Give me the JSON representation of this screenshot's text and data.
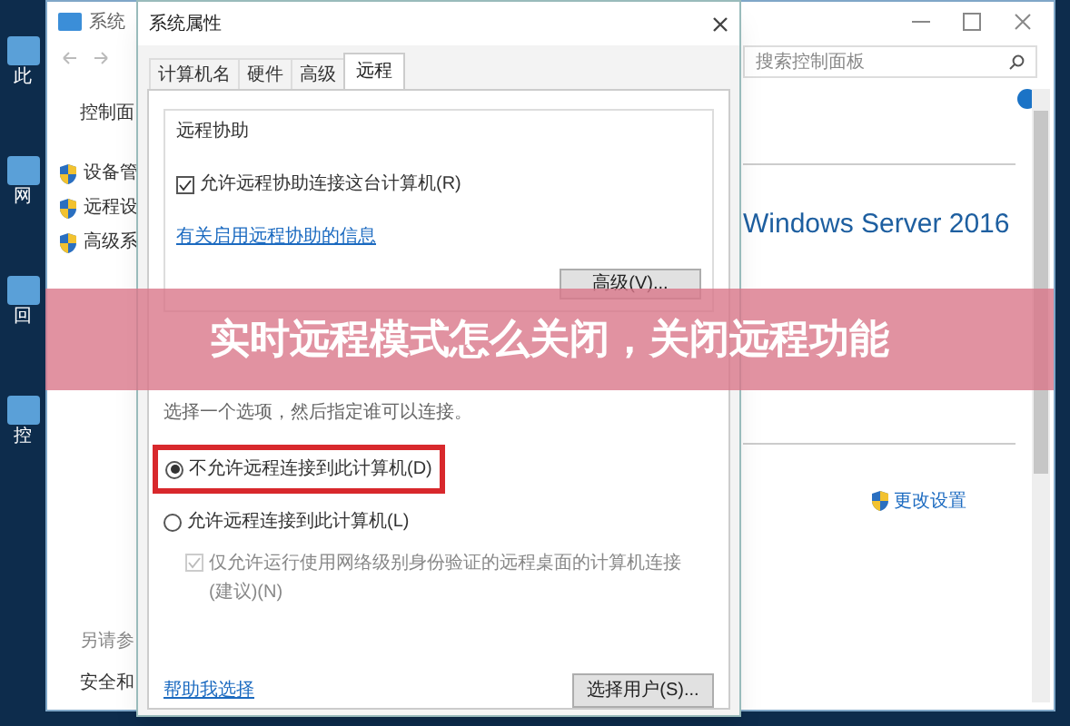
{
  "desktop": {
    "icons": [
      {
        "label": "此"
      },
      {
        "label": "网"
      },
      {
        "label": "回"
      },
      {
        "label": "控"
      }
    ]
  },
  "control_panel": {
    "title": "系统",
    "search": {
      "placeholder": "搜索控制面板"
    },
    "nav": {
      "home": "控制面",
      "items": [
        "设备管",
        "远程设",
        "高级系"
      ],
      "see_also": "另请参",
      "see_also_items": [
        "安全和"
      ]
    },
    "content": {
      "edition": "Windows Server 2016",
      "change_settings": "更改设置"
    }
  },
  "dialog": {
    "title": "系统属性",
    "tabs": [
      {
        "label": "计算机名",
        "selected": false
      },
      {
        "label": "硬件",
        "selected": false
      },
      {
        "label": "高级",
        "selected": false
      },
      {
        "label": "远程",
        "selected": true
      }
    ],
    "remote_assistance": {
      "title": "远程协助",
      "allow": {
        "label": "允许远程协助连接这台计算机(R)",
        "checked": true
      },
      "link": "有关启用远程协助的信息",
      "advanced_button": "高级(V)..."
    },
    "remote_desktop": {
      "instruction": "选择一个选项，然后指定谁可以连接。",
      "options": [
        {
          "label": "不允许远程连接到此计算机(D)",
          "selected": true,
          "highlighted": true
        },
        {
          "label": "允许远程连接到此计算机(L)",
          "selected": false,
          "highlighted": false
        }
      ],
      "nla": {
        "label": "仅允许运行使用网络级别身份验证的远程桌面的计算机连接(建议)(N)",
        "checked": true,
        "disabled": true
      },
      "help_link": "帮助我选择",
      "select_users_button": "选择用户(S)..."
    }
  },
  "banner": {
    "title": "实时远程模式怎么关闭，关闭远程功能"
  }
}
